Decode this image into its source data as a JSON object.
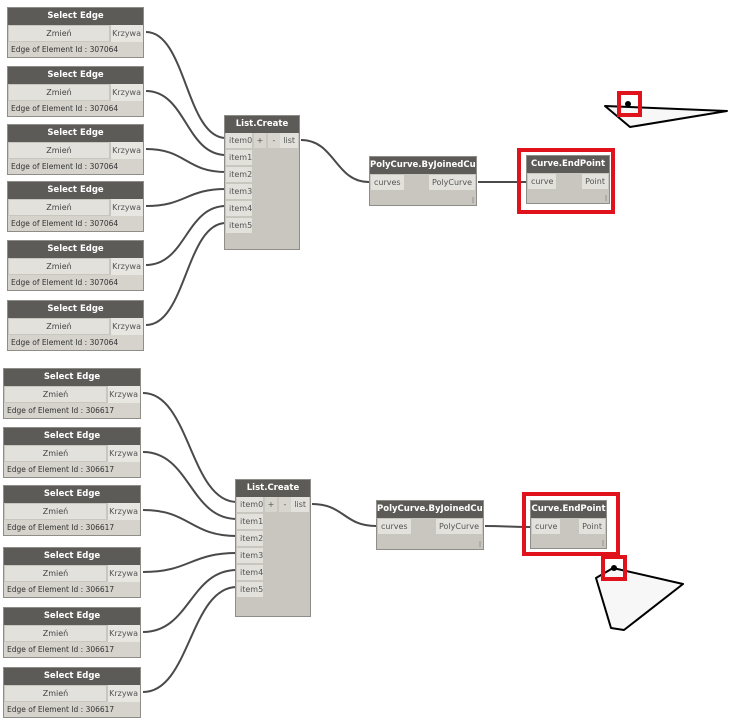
{
  "select_edge_groups": [
    {
      "nodes": [
        {
          "title": "Select Edge",
          "button": "Zmień",
          "output": "Krzywa",
          "status": "Edge of Element Id : 307064"
        },
        {
          "title": "Select Edge",
          "button": "Zmień",
          "output": "Krzywa",
          "status": "Edge of Element Id : 307064"
        },
        {
          "title": "Select Edge",
          "button": "Zmień",
          "output": "Krzywa",
          "status": "Edge of Element Id : 307064"
        },
        {
          "title": "Select Edge",
          "button": "Zmień",
          "output": "Krzywa",
          "status": "Edge of Element Id : 307064"
        },
        {
          "title": "Select Edge",
          "button": "Zmień",
          "output": "Krzywa",
          "status": "Edge of Element Id : 307064"
        },
        {
          "title": "Select Edge",
          "button": "Zmień",
          "output": "Krzywa",
          "status": "Edge of Element Id : 307064"
        }
      ]
    },
    {
      "nodes": [
        {
          "title": "Select Edge",
          "button": "Zmień",
          "output": "Krzywa",
          "status": "Edge of Element Id : 306617"
        },
        {
          "title": "Select Edge",
          "button": "Zmień",
          "output": "Krzywa",
          "status": "Edge of Element Id : 306617"
        },
        {
          "title": "Select Edge",
          "button": "Zmień",
          "output": "Krzywa",
          "status": "Edge of Element Id : 306617"
        },
        {
          "title": "Select Edge",
          "button": "Zmień",
          "output": "Krzywa",
          "status": "Edge of Element Id : 306617"
        },
        {
          "title": "Select Edge",
          "button": "Zmień",
          "output": "Krzywa",
          "status": "Edge of Element Id : 306617"
        },
        {
          "title": "Select Edge",
          "button": "Zmień",
          "output": "Krzywa",
          "status": "Edge of Element Id : 306617"
        }
      ]
    }
  ],
  "list_create": {
    "title": "List.Create",
    "inputs": [
      "item0",
      "item1",
      "item2",
      "item3",
      "item4",
      "item5"
    ],
    "add": "+",
    "remove": "-",
    "output": "list"
  },
  "polycurve": {
    "title": "PolyCurve.ByJoinedCurves",
    "input": "curves",
    "output": "PolyCurve"
  },
  "endpoint": {
    "title": "Curve.EndPoint",
    "input": "curve",
    "output": "Point"
  },
  "lacing": "|",
  "colors": {
    "highlight": "#e0121b",
    "node_header": "#5d5b58",
    "node_body": "#c9c6bf",
    "wire": "#4a4a4a"
  }
}
